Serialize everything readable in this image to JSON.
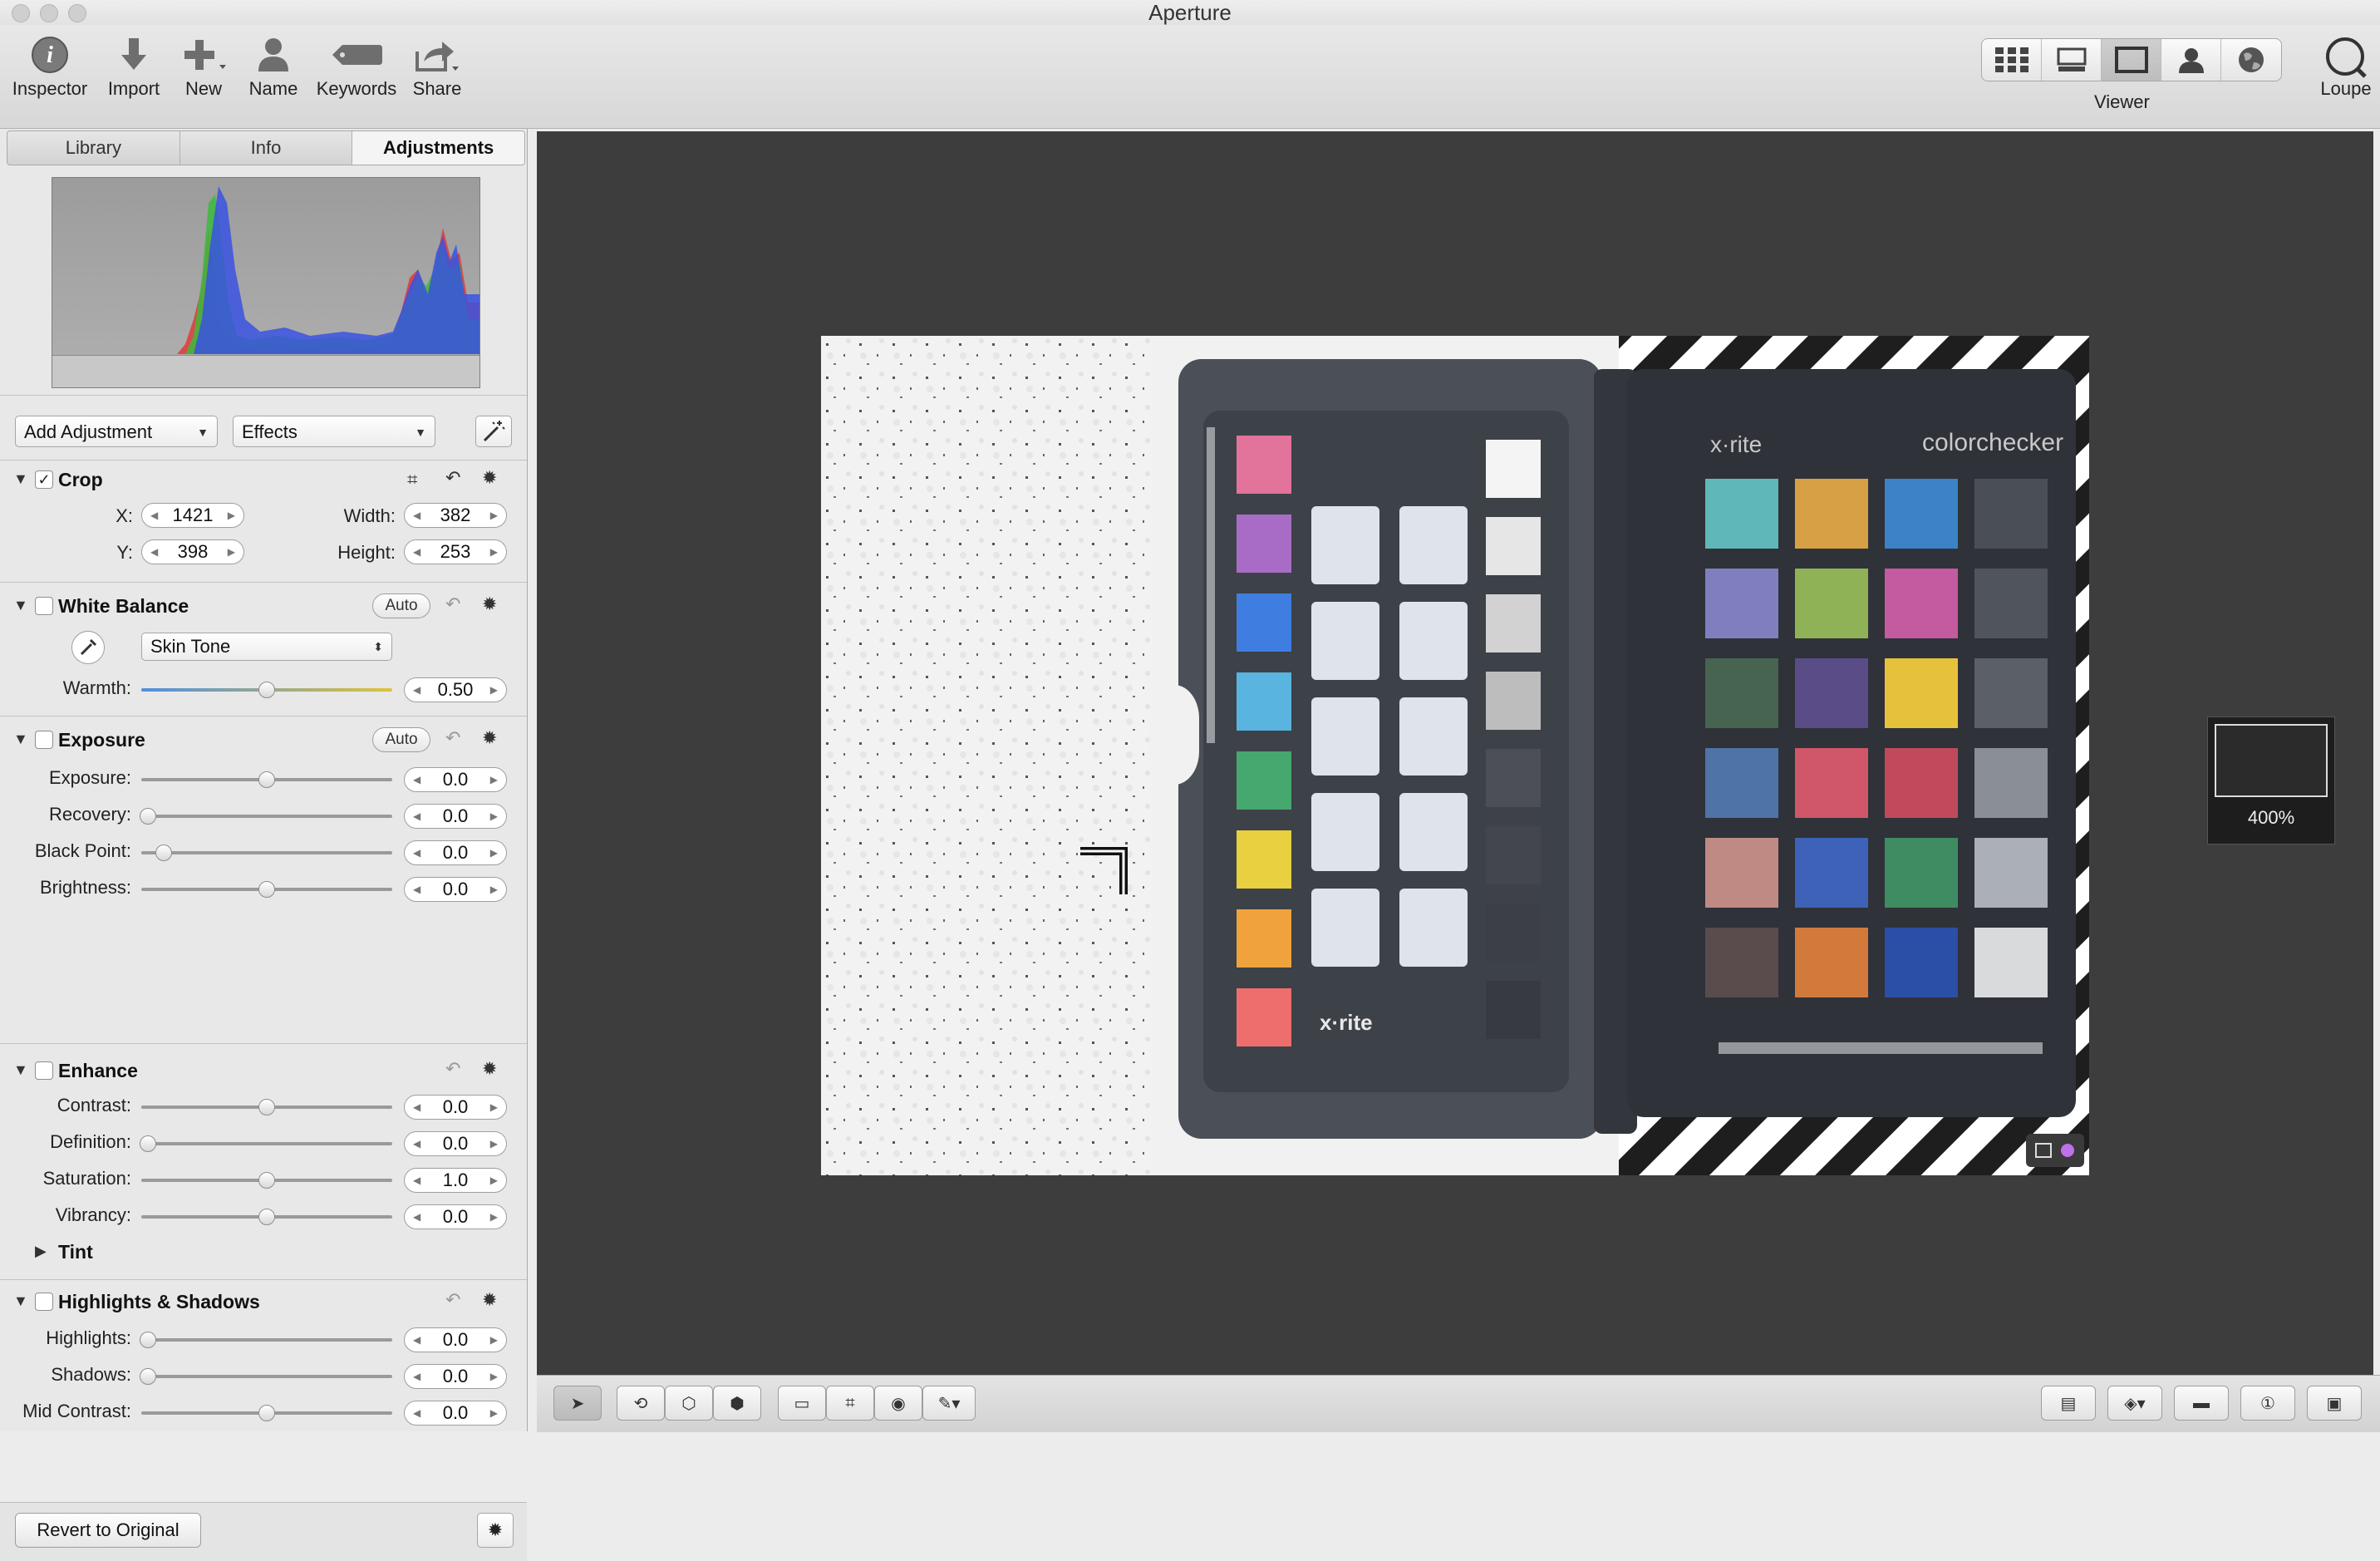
{
  "window": {
    "title": "Aperture"
  },
  "toolbar": {
    "inspector": "Inspector",
    "import": "Import",
    "new": "New",
    "name": "Name",
    "keywords": "Keywords",
    "share": "Share",
    "viewer": "Viewer",
    "loupe": "Loupe"
  },
  "tabs": [
    "Library",
    "Info",
    "Adjustments"
  ],
  "active_tab": "Adjustments",
  "menus": {
    "add_adjustment": "Add Adjustment",
    "effects": "Effects"
  },
  "crop": {
    "title": "Crop",
    "enabled": true,
    "x_label": "X:",
    "x": "1421",
    "y_label": "Y:",
    "y": "398",
    "width_label": "Width:",
    "width": "382",
    "height_label": "Height:",
    "height": "253"
  },
  "white_balance": {
    "title": "White Balance",
    "enabled": false,
    "auto": "Auto",
    "mode": "Skin Tone",
    "warmth_label": "Warmth:",
    "warmth": "0.50",
    "warmth_pos": 0.5
  },
  "exposure": {
    "title": "Exposure",
    "enabled": false,
    "auto": "Auto",
    "rows": [
      {
        "label": "Exposure:",
        "value": "0.0",
        "pos": 0.5
      },
      {
        "label": "Recovery:",
        "value": "0.0",
        "pos": 0.0
      },
      {
        "label": "Black Point:",
        "value": "0.0",
        "pos": 0.09
      },
      {
        "label": "Brightness:",
        "value": "0.0",
        "pos": 0.5
      }
    ]
  },
  "enhance": {
    "title": "Enhance",
    "enabled": false,
    "rows": [
      {
        "label": "Contrast:",
        "value": "0.0",
        "pos": 0.5
      },
      {
        "label": "Definition:",
        "value": "0.0",
        "pos": 0.0
      },
      {
        "label": "Saturation:",
        "value": "1.0",
        "pos": 0.5
      },
      {
        "label": "Vibrancy:",
        "value": "0.0",
        "pos": 0.5
      }
    ],
    "tint": "Tint"
  },
  "highlights_shadows": {
    "title": "Highlights & Shadows",
    "enabled": false,
    "rows": [
      {
        "label": "Highlights:",
        "value": "0.0",
        "pos": 0.0
      },
      {
        "label": "Shadows:",
        "value": "0.0",
        "pos": 0.0
      },
      {
        "label": "Mid Contrast:",
        "value": "0.0",
        "pos": 0.5
      }
    ]
  },
  "revert": "Revert to Original",
  "viewer": {
    "zoom": "400%"
  },
  "photo": {
    "brand_left": "x·rite",
    "brand_right_a": "x·rite",
    "brand_right_b": "colorchecker",
    "swatches_left": [
      "#e2739b",
      "#a86cc7",
      "#3f7ee0",
      "#5ab4e0",
      "#46a86e",
      "#e8d040",
      "#f0a33c",
      "#ee6e6e"
    ],
    "swatches_right": [
      [
        "#5fb7b9",
        "#d8a045",
        "#3b82c6",
        "#4a4f56"
      ],
      [
        "#7f7fc0",
        "#8fb257",
        "#c45aa0",
        "#50545b"
      ],
      [
        "#466450",
        "#5a4c86",
        "#e6c13c",
        "#5b6066"
      ],
      [
        "#4f73a6",
        "#d0566a",
        "#c04a5c",
        "#8a8f95"
      ],
      [
        "#c08a84",
        "#3d62b8",
        "#3f8c62",
        "#aab0b5"
      ],
      [
        "#5a4c4c",
        "#d27a3c",
        "#2b4ea6",
        "#d8dadc"
      ]
    ],
    "accent_pink": "#e03c8c",
    "accent_purple": "#c070e8"
  }
}
